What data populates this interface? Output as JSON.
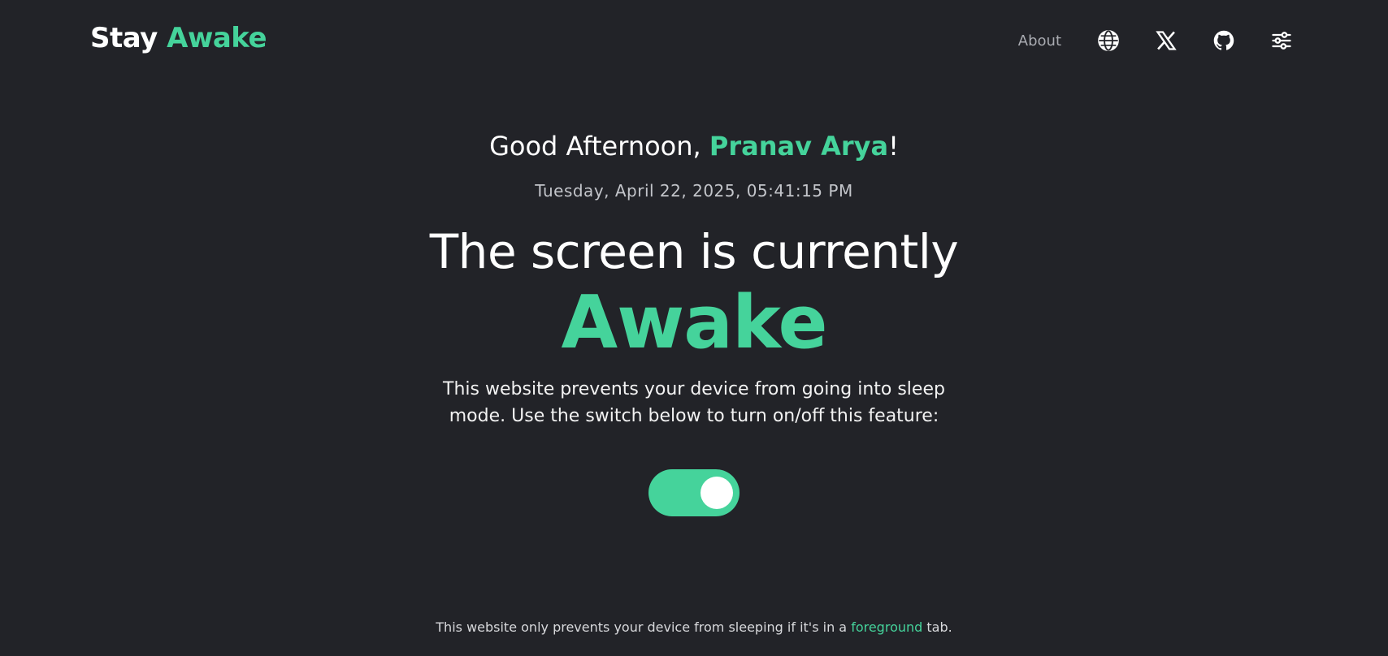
{
  "header": {
    "brand_part1": "Stay ",
    "brand_part2": "Awake",
    "nav": {
      "about_label": "About",
      "icons": [
        "globe-icon",
        "x-logo-icon",
        "github-icon",
        "settings-sliders-icon"
      ]
    }
  },
  "main": {
    "greeting_prefix": "Good Afternoon, ",
    "greeting_name": "Pranav Arya",
    "greeting_suffix": "!",
    "datetime": "Tuesday, April 22, 2025, 05:41:15 PM",
    "headline": "The screen is currently",
    "status": "Awake",
    "description": "This website prevents your device from going into sleep mode. Use the switch below to turn on/off this feature:",
    "toggle_on": true
  },
  "footer": {
    "text_before": "This website only prevents your device from sleeping if it's in a ",
    "highlight": "foreground",
    "text_after": " tab."
  },
  "colors": {
    "background": "#222328",
    "accent": "#45d39b",
    "muted_text": "#a9abb1"
  }
}
